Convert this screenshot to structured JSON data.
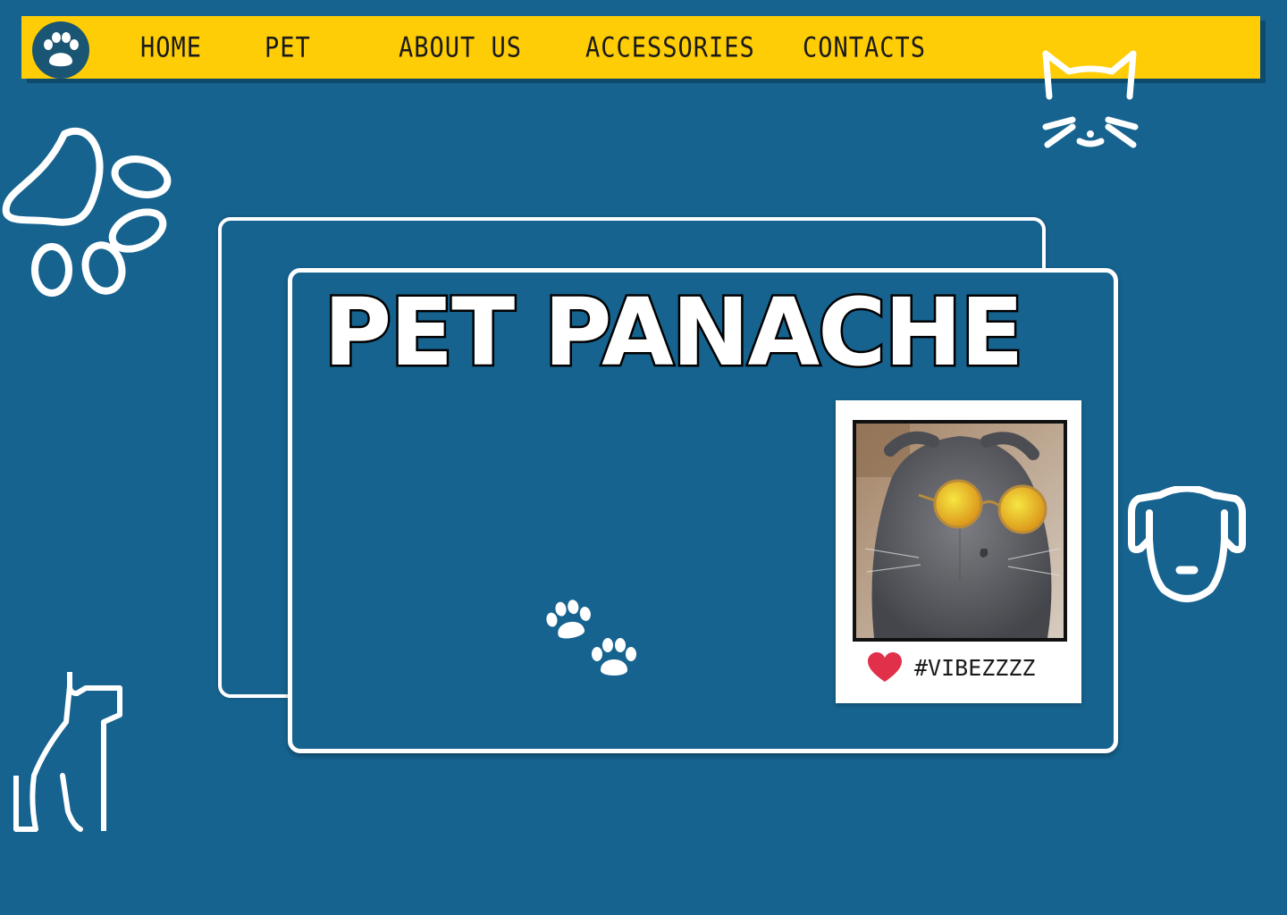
{
  "nav": {
    "logo_icon": "paw-icon",
    "items": [
      {
        "label": "HOME"
      },
      {
        "label": "PET"
      },
      {
        "label": "ABOUT US"
      },
      {
        "label": "ACCESSORIES"
      },
      {
        "label": "CONTACTS"
      }
    ]
  },
  "hero": {
    "title": "PET PANACHE"
  },
  "polaroid": {
    "photo_icon": "cat-with-sunglasses-photo",
    "like_icon": "heart-icon",
    "hashtag": "#VIBEZZZZ"
  },
  "decorations": [
    "paw-print-icon",
    "cat-face-icon",
    "dog-face-icon",
    "sitting-dog-icon",
    "small-paws-icon"
  ],
  "colors": {
    "background": "#16638f",
    "navbar": "#ffcd05",
    "outline": "#ffffff",
    "heart": "#e0304a"
  }
}
